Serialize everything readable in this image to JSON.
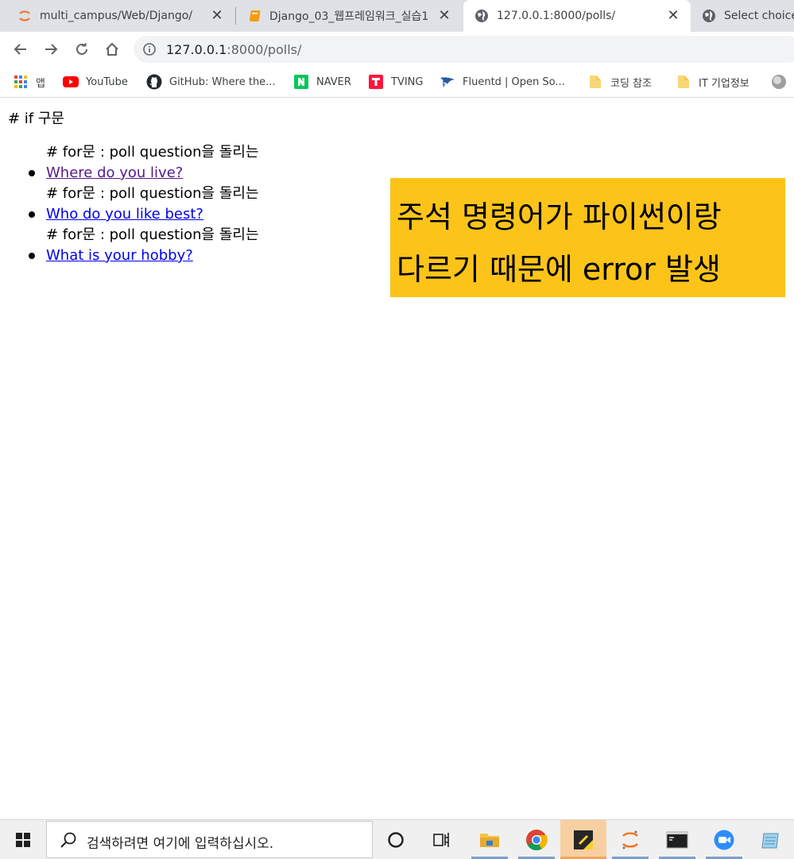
{
  "tabs": [
    {
      "title": "multi_campus/Web/Django/",
      "icon": "jupyter-icon"
    },
    {
      "title": "Django_03_웹프레임워크_실습1",
      "icon": "notebook-icon"
    },
    {
      "title": "127.0.0.1:8000/polls/",
      "icon": "globe-icon",
      "active": true
    },
    {
      "title": "Select choice",
      "icon": "globe-icon"
    }
  ],
  "toolbar": {
    "url_host": "127.0.0.1",
    "url_rest": ":8000/polls/"
  },
  "bookmarks": [
    {
      "label": "앱",
      "icon": "apps-grid-icon"
    },
    {
      "label": "YouTube",
      "icon": "youtube-icon"
    },
    {
      "label": "GitHub: Where the...",
      "icon": "github-icon"
    },
    {
      "label": "NAVER",
      "icon": "naver-icon"
    },
    {
      "label": "TVING",
      "icon": "tving-icon"
    },
    {
      "label": "Fluentd | Open So...",
      "icon": "fluentd-icon"
    },
    {
      "label": "코딩 참조",
      "icon": "folder-icon"
    },
    {
      "label": "IT 기업정보",
      "icon": "folder-icon"
    }
  ],
  "page": {
    "if_comment": "# if 구문",
    "for_comment": "# for문 : poll question을 돌리는",
    "questions": [
      {
        "text": "Where do you live?",
        "visited": true
      },
      {
        "text": "Who do you like best?",
        "visited": false
      },
      {
        "text": "What is your hobby?",
        "visited": false
      }
    ],
    "note_line1": "주석 명령어가 파이썬이랑",
    "note_line2": "다르기 때문에 error 발생",
    "note_color": "#fcc419"
  },
  "taskbar": {
    "search_placeholder": "검색하려면 여기에 입력하십시오.",
    "apps": [
      "cortana-icon",
      "task-view-icon",
      "file-explorer-icon",
      "chrome-icon",
      "sticky-notes-icon",
      "jupyter-icon",
      "terminal-icon",
      "zoom-icon",
      "notepad-icon"
    ]
  }
}
